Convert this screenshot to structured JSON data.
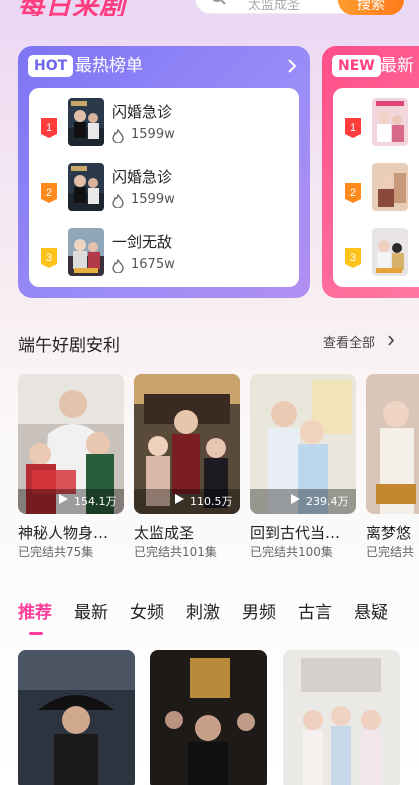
{
  "header": {
    "brand": "每日来剧",
    "search_placeholder": "太监成圣",
    "search_button": "搜索"
  },
  "hot_chart": {
    "tag": "HOT",
    "title": "最热榜单",
    "items": [
      {
        "rank": "1",
        "title": "闪婚急诊",
        "heat": "1599w"
      },
      {
        "rank": "2",
        "title": "闪婚急诊",
        "heat": "1599w"
      },
      {
        "rank": "3",
        "title": "一剑无敌",
        "heat": "1675w"
      }
    ]
  },
  "new_chart": {
    "tag": "NEW",
    "title": "最新",
    "items": [
      {
        "rank": "1"
      },
      {
        "rank": "2"
      },
      {
        "rank": "3"
      }
    ]
  },
  "featured": {
    "title": "端午好剧安利",
    "more": "查看全部",
    "items": [
      {
        "title": "神秘人物身…",
        "status": "已完结共75集",
        "views": "154.1万"
      },
      {
        "title": "太监成圣",
        "status": "已完结共101集",
        "views": "110.5万"
      },
      {
        "title": "回到古代当…",
        "status": "已完结共100集",
        "views": "239.4万"
      },
      {
        "title": "离梦悠",
        "status": "已完结共",
        "views": ""
      }
    ]
  },
  "tabs": [
    "推荐",
    "最新",
    "女频",
    "刺激",
    "男频",
    "古言",
    "悬疑"
  ],
  "colors": {
    "accent_pink": "#ff3d9a",
    "hot_card": "#7d74f5",
    "new_card": "#ff4f88",
    "search_button": "#ff8a25"
  }
}
